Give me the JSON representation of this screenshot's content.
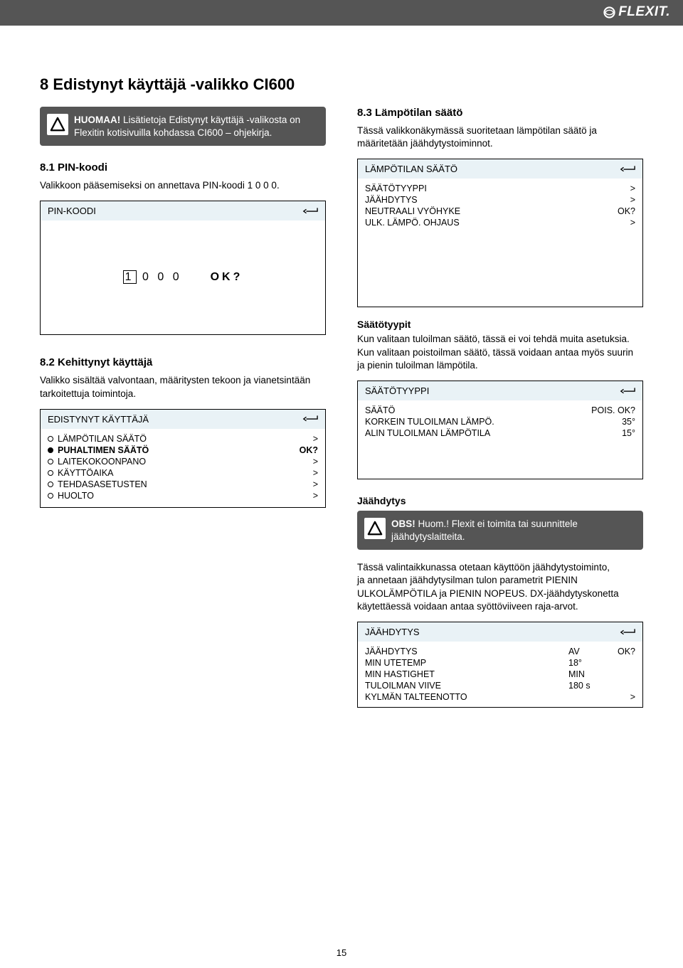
{
  "brand": "FLEXIT.",
  "page_number": "15",
  "headings": {
    "h1": "8    Edistynyt käyttäjä -valikko CI600",
    "h_8_1": "8.1    PIN-koodi",
    "h_8_2": "8.2    Kehittynyt käyttäjä",
    "h_8_3": "8.3    Lämpötilan säätö",
    "sub_saatotyypit": "Säätötyypit",
    "sub_jaahdytys": "Jäähdytys"
  },
  "notice1": {
    "strong": "HUOMAA!",
    "text": " Lisätietoja Edistynyt käyttäjä -valikosta on Flexitin kotisivuilla kohdassa CI600 – ohjekirja."
  },
  "notice2": {
    "strong": "OBS!",
    "text": " Huom.! Flexit ei toimita tai suunnittele jäähdytyslaitteita."
  },
  "paras": {
    "p_8_1": "Valikkoon pääsemiseksi on annettava PIN-koodi 1 0 0 0.",
    "p_8_2": "Valikko sisältää valvontaan, määritysten tekoon ja vianetsintään tarkoitettuja toimintoja.",
    "p_8_3": "Tässä valikkonäkymässä suoritetaan lämpötilan säätö ja määritetään jäähdytystoiminnot.",
    "p_saato": "Kun valitaan tuloilman säätö, tässä ei voi tehdä muita asetuksia. Kun valitaan poistoilman säätö, tässä voidaan antaa myös suurin ja pienin tuloilman lämpötila.",
    "p_jaahdytys": "Tässä valintaikkunassa otetaan käyttöön jäähdytystoiminto,\nja annetaan jäähdytysilman tulon parametrit PIENIN ULKOLÄMPÖTILA ja PIENIN NOPEUS.  DX-jäähdytyskonetta käytettäessä voidaan antaa syöttöviiveen raja-arvot."
  },
  "screens": {
    "pin": {
      "title": "PIN-KOODI",
      "digits": [
        "1",
        "0",
        "0",
        "0"
      ],
      "ok": "OK?"
    },
    "adv_user": {
      "title": "EDISTYNYT KÄYTTÄJÄ",
      "rows": [
        {
          "label": "LÄMPÖTILAN SÄÄTÖ",
          "val": ">",
          "selected": false,
          "bold": false
        },
        {
          "label": "PUHALTIMEN SÄÄTÖ",
          "val": "OK?",
          "selected": true,
          "bold": true
        },
        {
          "label": "LAITEKOKOONPANO",
          "val": ">",
          "selected": false,
          "bold": false
        },
        {
          "label": "KÄYTTÖAIKA",
          "val": ">",
          "selected": false,
          "bold": false
        },
        {
          "label": "TEHDASASETUSTEN",
          "val": ">",
          "selected": false,
          "bold": false
        },
        {
          "label": "HUOLTO",
          "val": ">",
          "selected": false,
          "bold": false
        }
      ]
    },
    "temp_ctrl": {
      "title": "LÄMPÖTILAN SÄÄTÖ",
      "rows": [
        {
          "label": "SÄÄTÖTYYPPI",
          "val": ">"
        },
        {
          "label": "JÄÄHDYTYS",
          "val": ">"
        },
        {
          "label": "NEUTRAALI VYÖHYKE",
          "val": "OK?"
        },
        {
          "label": "ULK. LÄMPÖ. OHJAUS",
          "val": ">"
        }
      ]
    },
    "saatotyyppi": {
      "title": "SÄÄTÖTYYPPI",
      "rows": [
        {
          "label": "SÄÄTÖ",
          "val": "POIS. OK?"
        },
        {
          "label": "KORKEIN TULOILMAN LÄMPÖ.",
          "val": "35°"
        },
        {
          "label": "ALIN TULOILMAN LÄMPÖTILA",
          "val": "15°"
        }
      ]
    },
    "jaahdytys": {
      "title": "JÄÄHDYTYS",
      "rows": [
        {
          "label": "JÄÄHDYTYS",
          "v1": "AV",
          "v2": "OK?"
        },
        {
          "label": "MIN UTETEMP",
          "v1": "18°",
          "v2": ""
        },
        {
          "label": "MIN HASTIGHET",
          "v1": "MIN",
          "v2": ""
        },
        {
          "label": "TULOILMAN VIIVE",
          "v1": "180 s",
          "v2": ""
        },
        {
          "label": "KYLMÄN TALTEENOTTO",
          "v1": "",
          "v2": ">"
        }
      ]
    }
  }
}
